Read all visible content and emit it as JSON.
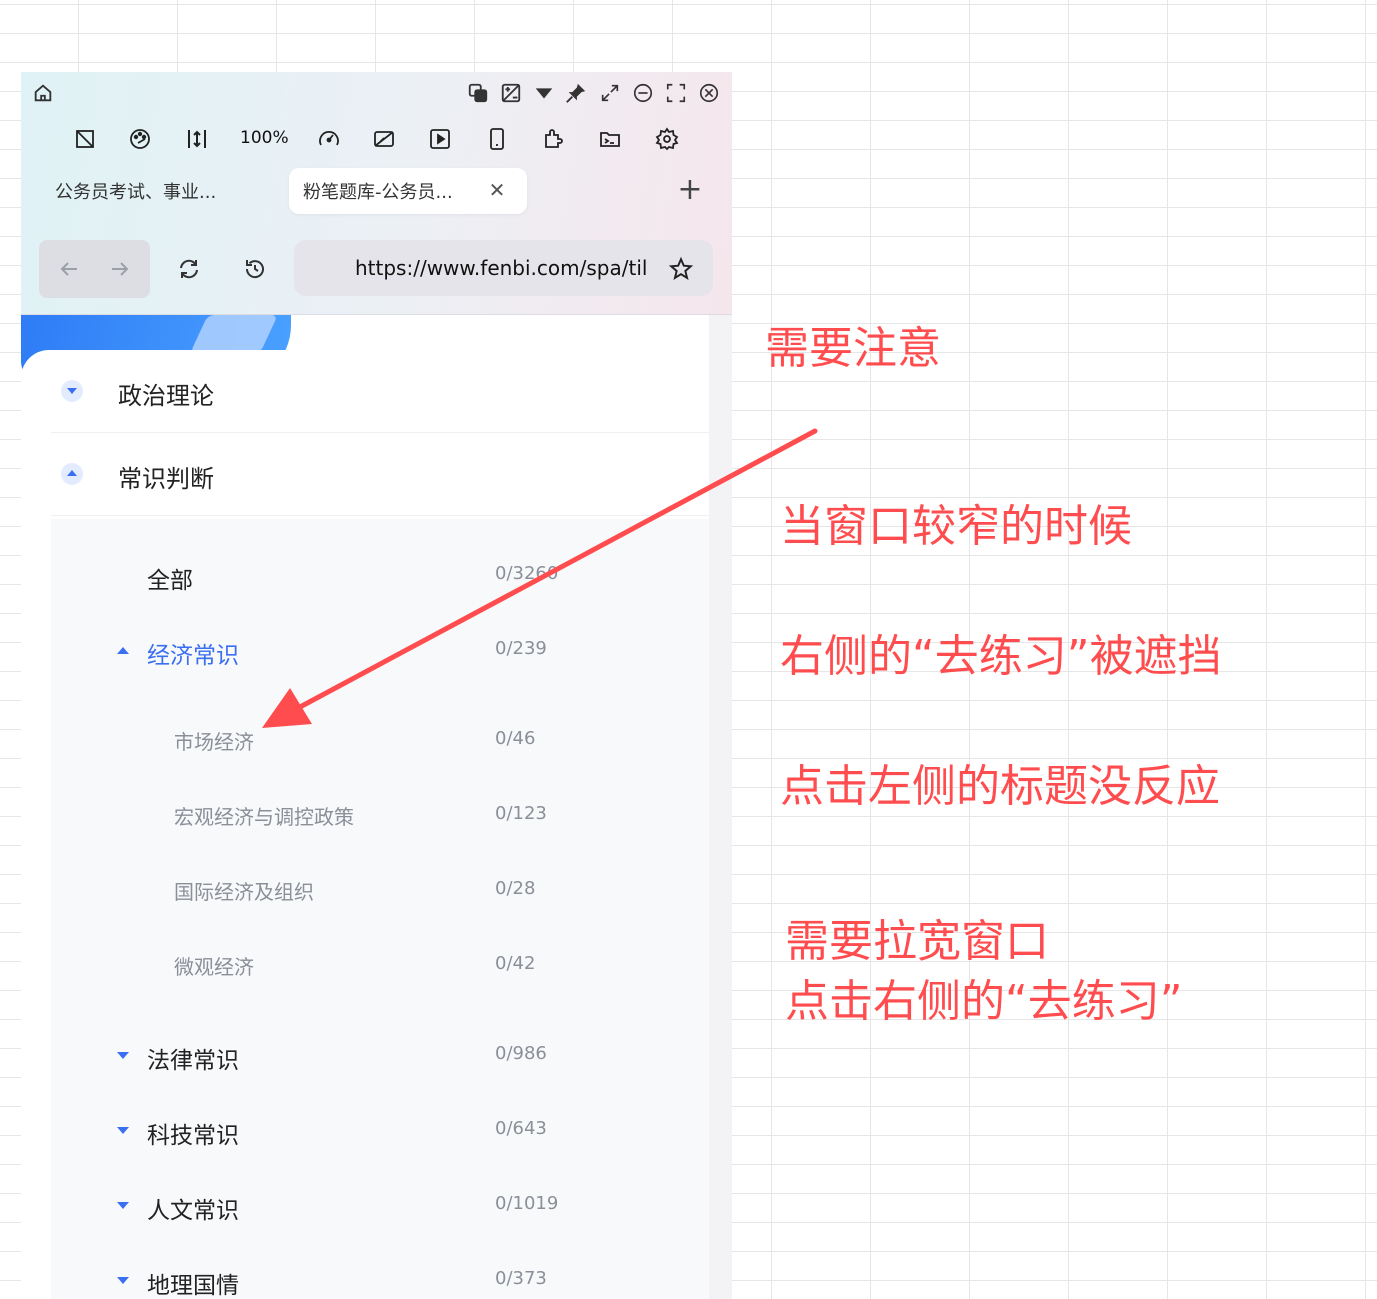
{
  "browser": {
    "zoom": "100%",
    "tabs": [
      {
        "label": "公务员考试、事业..."
      },
      {
        "label": "粉笔题库-公务员...",
        "close": "✕"
      }
    ],
    "new_tab": "+",
    "url": "https://www.fenbi.com/spa/til"
  },
  "sections": [
    {
      "label": "政治理论",
      "state": "collapsed"
    },
    {
      "label": "常识判断",
      "state": "expanded"
    }
  ],
  "tree": [
    {
      "label": "全部",
      "count": "0/3260",
      "level": 0
    },
    {
      "label": "经济常识",
      "count": "0/239",
      "level": 1,
      "state": "expanded"
    },
    {
      "label": "市场经济",
      "count": "0/46",
      "level": 2
    },
    {
      "label": "宏观经济与调控政策",
      "count": "0/123",
      "level": 2
    },
    {
      "label": "国际经济及组织",
      "count": "0/28",
      "level": 2
    },
    {
      "label": "微观经济",
      "count": "0/42",
      "level": 2
    },
    {
      "label": "法律常识",
      "count": "0/986",
      "level": 1,
      "state": "collapsed"
    },
    {
      "label": "科技常识",
      "count": "0/643",
      "level": 1,
      "state": "collapsed"
    },
    {
      "label": "人文常识",
      "count": "0/1019",
      "level": 1,
      "state": "collapsed"
    },
    {
      "label": "地理国情",
      "count": "0/373",
      "level": 1,
      "state": "collapsed"
    }
  ],
  "annotations": {
    "note1": "需要注意",
    "note2": "当窗口较窄的时候",
    "note3": "右侧的“去练习”被遮挡",
    "note4": "点击左侧的标题没反应",
    "note5a": "需要拉宽窗口",
    "note5b": "点击右侧的“去练习”"
  },
  "colors": {
    "annotation": "#ff4d4f",
    "accent": "#3a6ff0"
  },
  "icons": [
    "home-icon",
    "copy-icon",
    "image-compare-icon",
    "dropdown-icon",
    "pin-icon",
    "resize-icon",
    "minimize-icon",
    "fullscreen-icon",
    "close-window-icon",
    "no-image-icon",
    "palette-icon",
    "text-spacing-icon",
    "speed-icon",
    "screenshot-icon",
    "video-icon",
    "mobile-icon",
    "extension-icon",
    "terminal-icon",
    "settings-icon",
    "back-icon",
    "forward-icon",
    "refresh-icon",
    "history-icon",
    "star-icon"
  ]
}
